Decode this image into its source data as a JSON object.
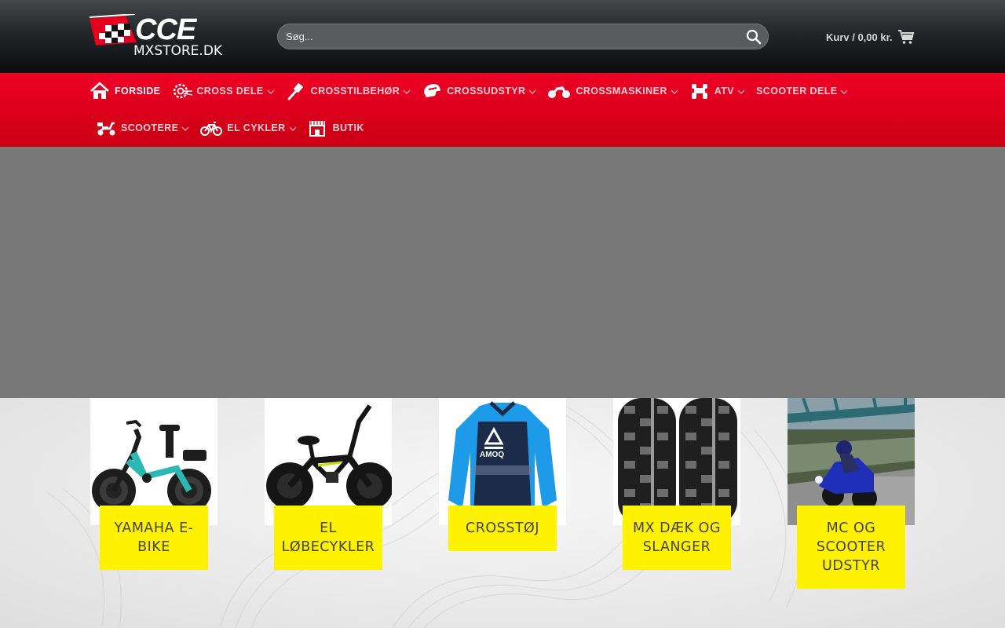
{
  "header": {
    "logo_top": "CCE",
    "logo_bottom": "MXSTORE.DK",
    "search": {
      "placeholder": "Søg..."
    },
    "cart": {
      "label": "Kurv / 0,00 kr."
    }
  },
  "nav": {
    "row1": [
      {
        "label": "Forside",
        "icon": "home-icon",
        "dropdown": false
      },
      {
        "label": "Cross dele",
        "icon": "gear-icon",
        "dropdown": true
      },
      {
        "label": "Crosstilbehør",
        "icon": "tools-icon",
        "dropdown": true
      },
      {
        "label": "Crossudstyr",
        "icon": "helmet-icon",
        "dropdown": true
      },
      {
        "label": "Crossmaskiner",
        "icon": "motocross-bike-icon",
        "dropdown": true
      },
      {
        "label": "ATV",
        "icon": "atv-icon",
        "dropdown": true
      },
      {
        "label": "Scooter dele",
        "icon": "",
        "dropdown": true
      }
    ],
    "row2": [
      {
        "label": "Scootere",
        "icon": "scooter-icon",
        "dropdown": true
      },
      {
        "label": "El cykler",
        "icon": "bicycle-icon",
        "dropdown": true
      },
      {
        "label": "Butik",
        "icon": "shop-icon",
        "dropdown": false
      }
    ]
  },
  "categories": [
    {
      "label": "Yamaha e-bike",
      "image": "e-bike"
    },
    {
      "label": "El løbecykler",
      "image": "balance-bike"
    },
    {
      "label": "Crosstøj",
      "image": "jersey",
      "jersey_brand": "AMOQ"
    },
    {
      "label": "MX dæk og slanger",
      "image": "tires"
    },
    {
      "label": "MC og scooter udstyr",
      "image": "motorcycle"
    }
  ],
  "colors": {
    "nav_red": "#e0001c",
    "label_yellow": "#fff200",
    "hero_gray": "#787878",
    "jersey_blue": "#1e9be8",
    "jersey_navy": "#1b2b4a"
  }
}
